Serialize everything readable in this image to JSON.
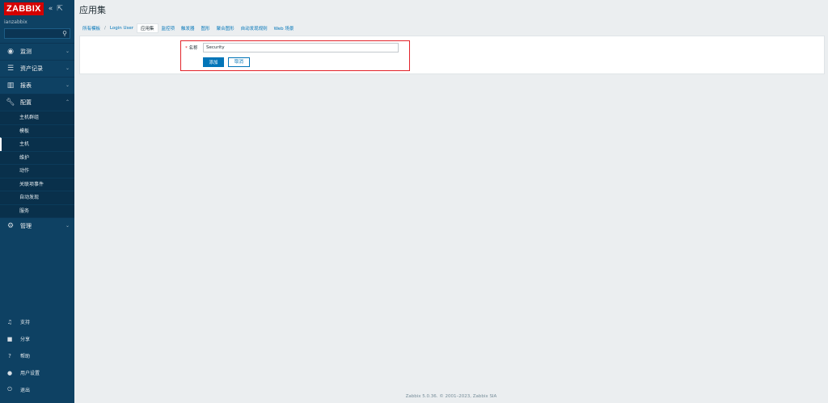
{
  "brand": {
    "logo": "ZABBIX",
    "user": "ianzabbix"
  },
  "sidebar": {
    "menu": [
      {
        "label": "监测",
        "icon": "eye-icon"
      },
      {
        "label": "资产记录",
        "icon": "list-icon"
      },
      {
        "label": "报表",
        "icon": "bar-chart-icon"
      },
      {
        "label": "配置",
        "icon": "wrench-icon"
      }
    ],
    "submenu": [
      "主机群组",
      "模板",
      "主机",
      "维护",
      "动作",
      "关联项事件",
      "自动发现",
      "服务"
    ],
    "admin": {
      "label": "管理",
      "icon": "gear-icon"
    },
    "bottom": [
      {
        "label": "支持",
        "icon": "headset-icon"
      },
      {
        "label": "分享",
        "icon": "share-icon"
      },
      {
        "label": "帮助",
        "icon": "help-icon"
      },
      {
        "label": "用户设置",
        "icon": "user-icon"
      },
      {
        "label": "退出",
        "icon": "power-icon"
      }
    ]
  },
  "header": {
    "title": "应用集"
  },
  "breadcrumb": {
    "all_hosts": "所有模板",
    "sep": "/",
    "host": "Login User"
  },
  "tabs": [
    "应用集",
    "监控项",
    "触发器",
    "图形",
    "聚合图形",
    "自动发现规则",
    "Web 场景"
  ],
  "form": {
    "required_mark": "*",
    "name_label": "名称",
    "name_value": "Security",
    "add_button": "添加",
    "cancel_button": "取消"
  },
  "footer": {
    "text": "Zabbix 5.0.36. © 2001–2023, Zabbix SIA"
  },
  "colors": {
    "sidebar": "#0e4163",
    "accent": "#0275b8",
    "logo": "#d40000",
    "highlight": "#e2232a"
  }
}
